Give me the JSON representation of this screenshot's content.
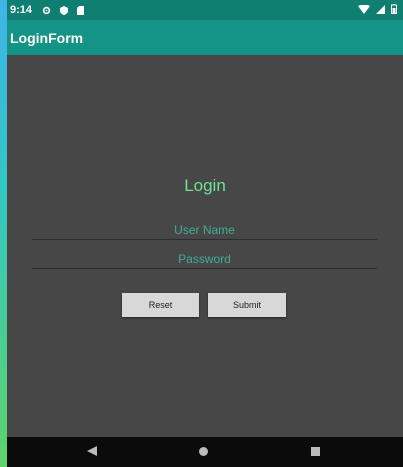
{
  "status_bar": {
    "time": "9:14",
    "left_icons": [
      "settings-icon",
      "shield-icon",
      "sd-card-icon"
    ],
    "right_icons": [
      "wifi-icon",
      "signal-icon",
      "battery-icon"
    ]
  },
  "app_bar": {
    "title": "LoginForm"
  },
  "form": {
    "title": "Login",
    "username_placeholder": "User Name",
    "password_placeholder": "Password",
    "reset_label": "Reset",
    "submit_label": "Submit"
  },
  "nav_bar": {
    "icons": [
      "back-icon",
      "home-icon",
      "recents-icon"
    ]
  },
  "colors": {
    "status_bar": "#0f7f72",
    "app_bar": "#139486",
    "background": "#474747",
    "accent_title": "#6fe38f",
    "hint_text": "#3fae96"
  }
}
